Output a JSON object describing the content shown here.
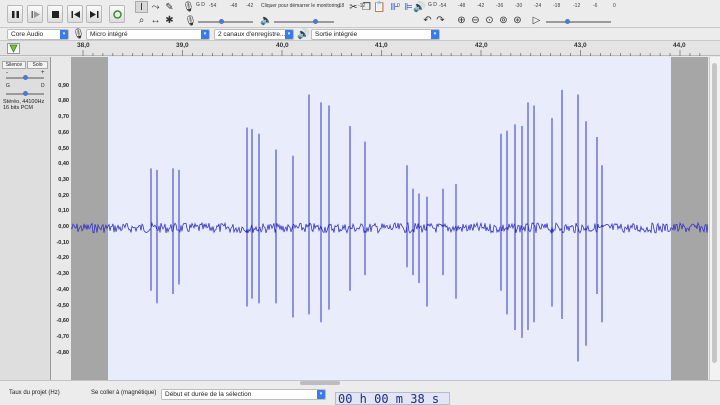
{
  "transport": {
    "buttons": [
      "pause",
      "play",
      "stop",
      "skip-to-start",
      "skip-to-end",
      "record"
    ]
  },
  "tools": [
    "selection",
    "envelope",
    "draw",
    "zoom",
    "time-shift",
    "multi"
  ],
  "record_meter": {
    "channels": "G D",
    "ticks": [
      "-54",
      "-48",
      "-42",
      "-18",
      "-12",
      "-6",
      "0"
    ],
    "prompt": "Cliquer pour démarrer le monitoring"
  },
  "play_meter": {
    "channels": "G D",
    "ticks": [
      "-54",
      "-48",
      "-42",
      "-36",
      "-30",
      "-24",
      "-18",
      "-12",
      "-6",
      "0"
    ]
  },
  "devices": {
    "host": "Core Audio",
    "input": "Micro intégré",
    "channels": "2 canaux d'enregistre...",
    "output": "Sortie intégrée"
  },
  "ruler": {
    "labels": [
      "38,0",
      "39,0",
      "40,0",
      "41,0",
      "42,0",
      "43,0",
      "44,0"
    ]
  },
  "track": {
    "mute_label": "Silence",
    "solo_label": "Solo",
    "gain_minus": "-",
    "gain_plus": "+",
    "pan_left": "G",
    "pan_right": "D",
    "info_line1": "Stéréo, 44100Hz",
    "info_line2": "16 bits PCM"
  },
  "yaxis": {
    "labels": [
      "0,90",
      "0,80",
      "0,70",
      "0,60",
      "0,50",
      "0,40",
      "0,30",
      "0,20",
      "0,10",
      "0,00",
      "-0,10",
      "-0,20",
      "-0,30",
      "-0,40",
      "-0,50",
      "-0,60",
      "-0,70",
      "-0,80"
    ]
  },
  "colors": {
    "waveform": "#3333c8",
    "wave_bg": "#e9edfb",
    "out_of_range_bg": "#a6a6a6",
    "accent": "#3a7bea"
  },
  "bottom": {
    "rate_label": "Taux du projet (Hz)",
    "snap_label": "Se coller à (magnétique)",
    "selection_mode": "Début et durée de la sélection",
    "time_value": "00 h 00 m 38 s"
  }
}
